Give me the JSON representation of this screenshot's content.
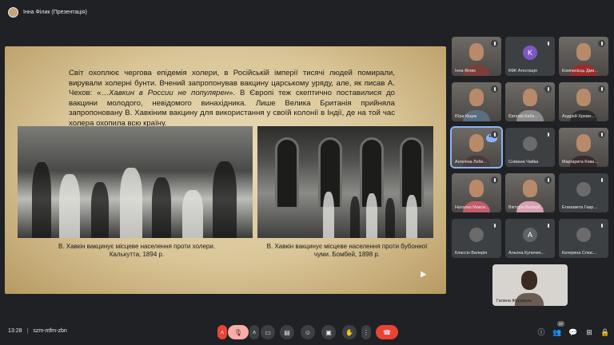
{
  "presenter": {
    "name": "Інна Філик (Презентація)"
  },
  "slide": {
    "paragraph_part1": "Світ охоплює чергова епідемія холери, в Російській імперії тисячі людей помирали, вирували холерні бунти. Вчений запропонував вакцину царському уряду, але, як писав А. Чехов: «…",
    "paragraph_italic": "Хавкин в России не популярен",
    "paragraph_part2": "». В Європі теж скептично поставилися до вакцини молодого, невідомого винахідника. Лише Велика Британія прийняла запропоновану В. Хавкіним вакцину для використання у своїй колонії в Індії, де на той час холера охопила всю країну.",
    "caption_left_line1": "В. Хавкін вакцинує місцеве населення проти холери.",
    "caption_left_line2": "Калькутта, 1894 р.",
    "caption_right_line1": "В. Хавкін вакцинує місцеве населення проти бубонної",
    "caption_right_line2": "чуми. Бомбей, 1898 р."
  },
  "participants": [
    {
      "name": "Інна Філик",
      "type": "video",
      "body": "#7a3f3a"
    },
    {
      "name": "КФК Атестація",
      "type": "avatar",
      "initial": "K",
      "color": "#7e57c2"
    },
    {
      "name": "Компанієць Дми...",
      "type": "video",
      "body": "#9b2d2d"
    },
    {
      "name": "Юра Кіщик",
      "type": "video",
      "body": "#5a6e7f"
    },
    {
      "name": "Євгенія Каба...",
      "type": "video",
      "body": "#8c8c8c"
    },
    {
      "name": "Андрей Хремн...",
      "type": "video",
      "body": "#2b2b2b"
    },
    {
      "name": "Ангеліна Лебе...",
      "type": "video",
      "body": "#4a3a3a",
      "active": true
    },
    {
      "name": "Сніжана Чайка",
      "type": "avatar",
      "initial": "",
      "color": "#6b6b6b"
    },
    {
      "name": "Маргарита Ковал...",
      "type": "video",
      "body": "#3a2a2a"
    },
    {
      "name": "Наталка Максим...",
      "type": "video",
      "body": "#c45a6a"
    },
    {
      "name": "Вікторія Валерії...",
      "type": "video",
      "body": "#d9a0b0"
    },
    {
      "name": "Елизавета Гаври...",
      "type": "avatar",
      "initial": "",
      "color": "#6b6b6b"
    },
    {
      "name": "Классін Валерія",
      "type": "avatar",
      "initial": "",
      "color": "#6b6b6b"
    },
    {
      "name": "Альона Кулачин...",
      "type": "avatar",
      "initial": "A",
      "color": "#5f6368"
    },
    {
      "name": "Катерина Слюс...",
      "type": "avatar",
      "initial": "",
      "color": "#6b6b6b"
    }
  ],
  "featured": {
    "name": "Галина Журавель"
  },
  "bottombar": {
    "time": "13:28",
    "meeting_code": "szm-ntfm-zbn",
    "participant_count": "17"
  },
  "colors": {
    "hangup": "#ea4335",
    "mic_off": "#f6aea9",
    "background": "#202124"
  }
}
